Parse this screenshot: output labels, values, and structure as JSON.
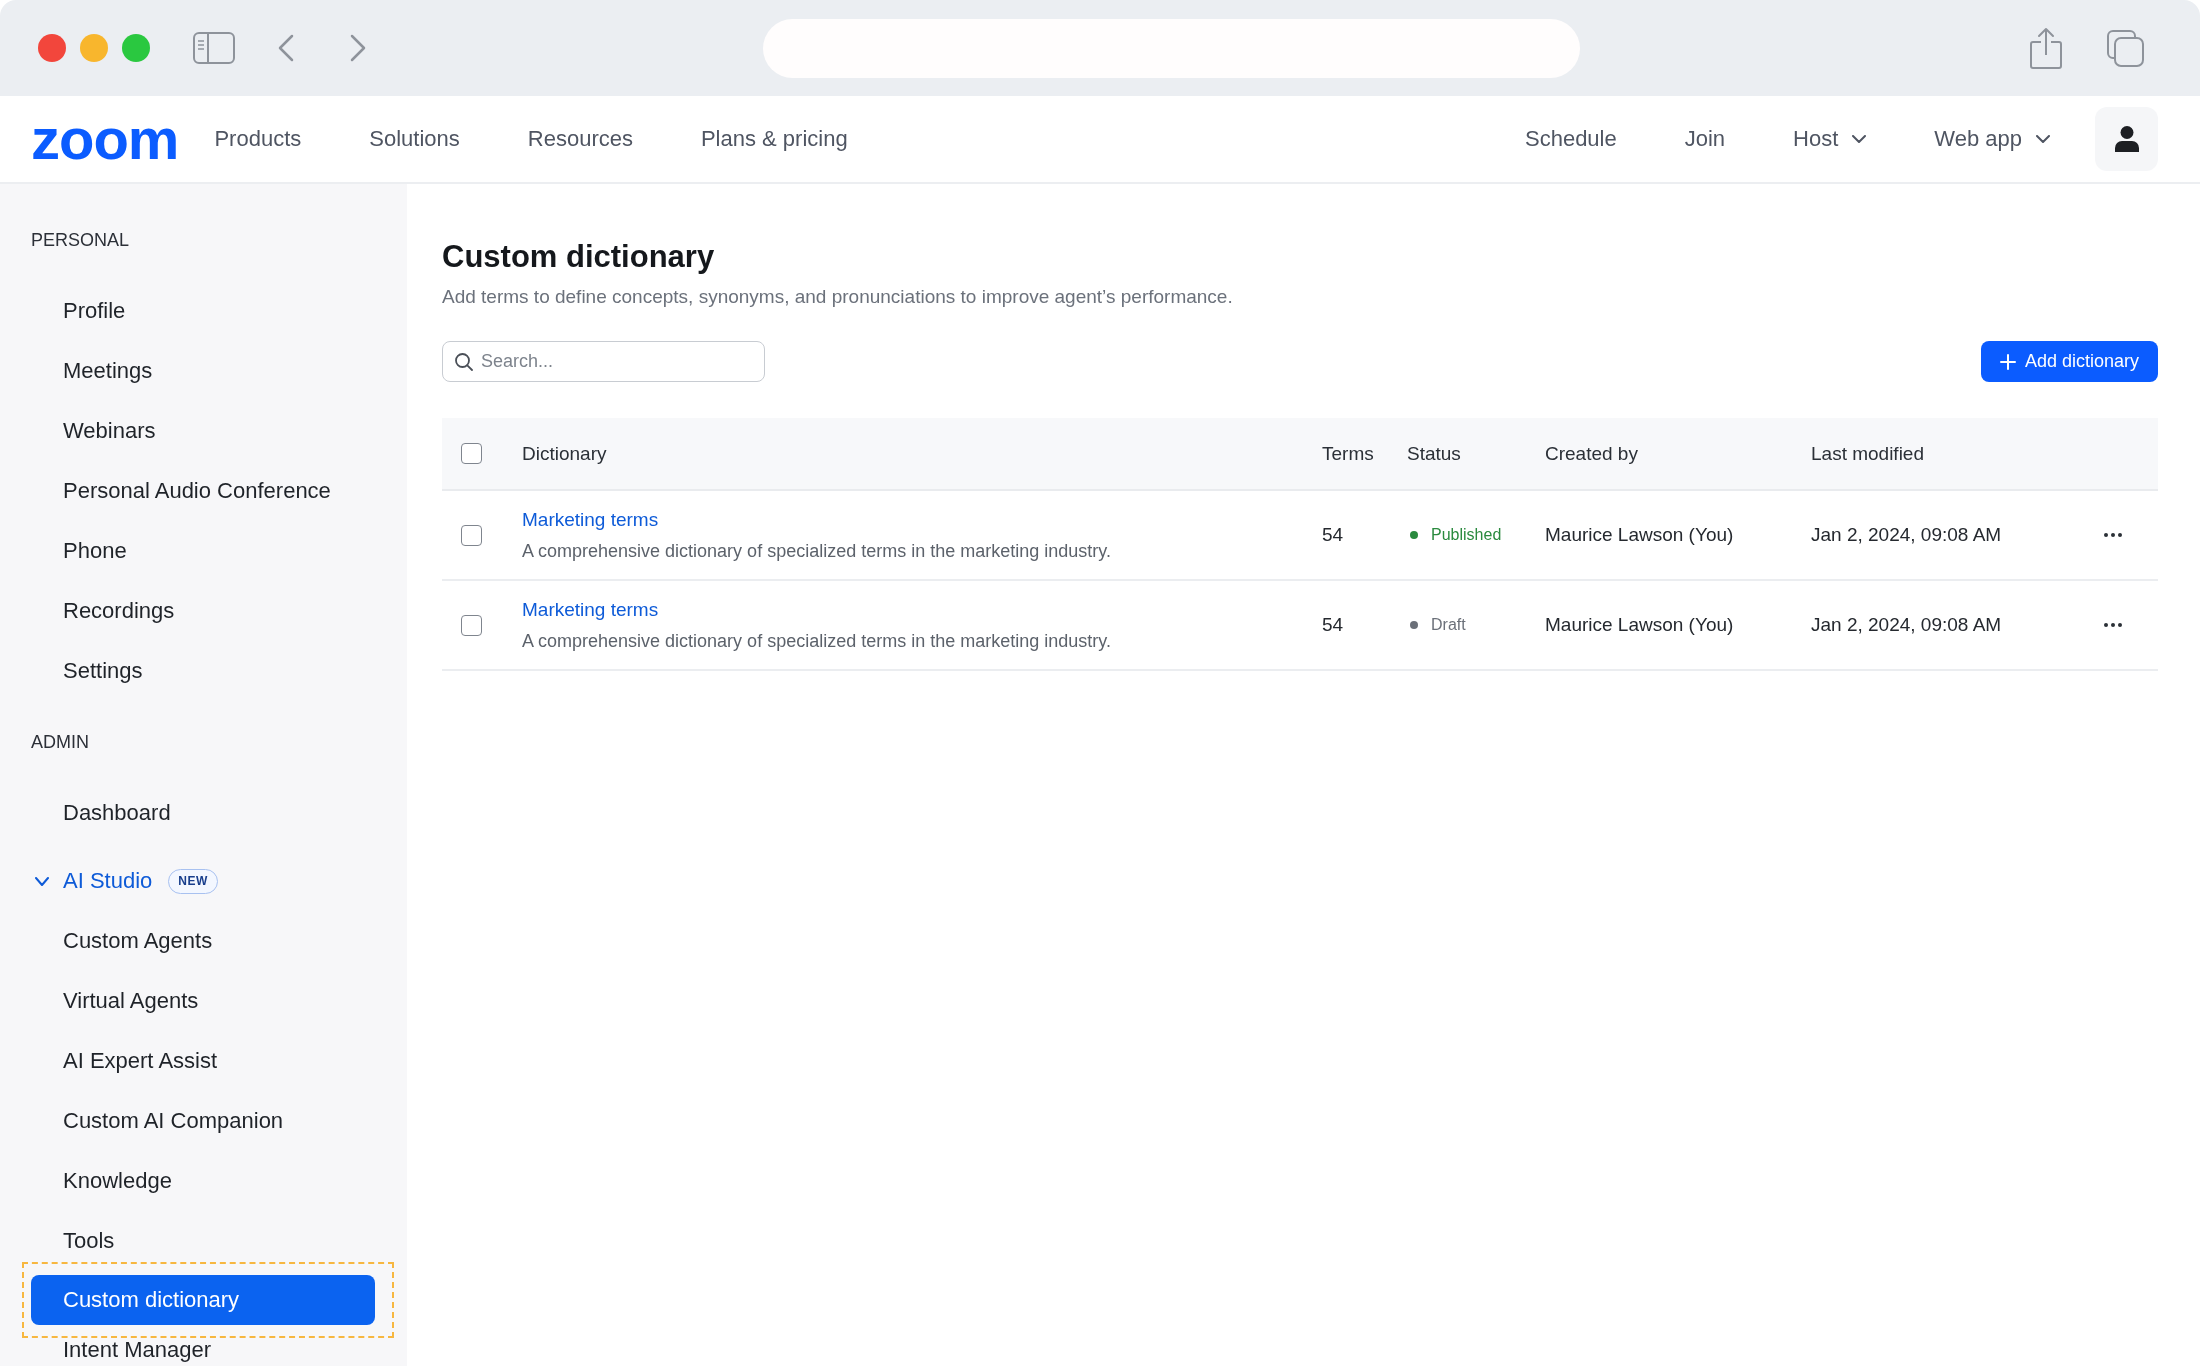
{
  "navbar": {
    "logo": "zoom",
    "links": [
      {
        "label": "Products"
      },
      {
        "label": "Solutions"
      },
      {
        "label": "Resources"
      },
      {
        "label": "Plans & pricing"
      }
    ],
    "actions": [
      {
        "label": "Schedule",
        "kind": "link"
      },
      {
        "label": "Join",
        "kind": "link"
      },
      {
        "label": "Host",
        "kind": "menu"
      },
      {
        "label": "Web app",
        "kind": "menu"
      }
    ]
  },
  "sidebar": {
    "sections": [
      {
        "heading": "PERSONAL",
        "items": [
          {
            "label": "Profile",
            "selected": false
          },
          {
            "label": "Meetings",
            "selected": false
          },
          {
            "label": "Webinars",
            "selected": false
          },
          {
            "label": "Personal Audio Conference",
            "selected": false
          },
          {
            "label": "Phone",
            "selected": false
          },
          {
            "label": "Recordings",
            "selected": false
          },
          {
            "label": "Settings",
            "selected": false
          }
        ]
      },
      {
        "heading": "ADMIN",
        "items": [
          {
            "label": "Dashboard",
            "selected": false
          },
          {
            "label": "AI Studio",
            "selected": false,
            "expanded": true,
            "badge": "NEW",
            "children": [
              {
                "label": "Custom Agents",
                "selected": false
              },
              {
                "label": "Virtual Agents",
                "selected": false
              },
              {
                "label": "AI Expert Assist",
                "selected": false
              },
              {
                "label": "Custom AI Companion",
                "selected": false
              },
              {
                "label": "Knowledge",
                "selected": false
              },
              {
                "label": "Tools",
                "selected": false
              },
              {
                "label": "Custom dictionary",
                "selected": true
              },
              {
                "label": "Intent Manager",
                "selected": false
              }
            ]
          }
        ]
      }
    ]
  },
  "page": {
    "title": "Custom dictionary",
    "description": "Add terms to define concepts, synonyms, and pronunciations to improve agent’s performance.",
    "search": {
      "placeholder": "Search..."
    },
    "add_button": "Add dictionary"
  },
  "table": {
    "header_checked": false,
    "columns": [
      {
        "label": "Dictionary"
      },
      {
        "label": "Terms"
      },
      {
        "label": "Status"
      },
      {
        "label": "Created by"
      },
      {
        "label": "Last modified"
      }
    ],
    "rows": [
      {
        "checked": false,
        "name": "Marketing terms",
        "description": "A comprehensive dictionary of specialized terms in the marketing industry.",
        "terms": "54",
        "status": {
          "label": "Published",
          "color": "#2a8a3e"
        },
        "created_by": "Maurice Lawson (You)",
        "last_modified": "Jan 2, 2024, 09:08 AM"
      },
      {
        "checked": false,
        "name": "Marketing terms",
        "description": "A comprehensive dictionary of specialized terms in the marketing industry.",
        "terms": "54",
        "status": {
          "label": "Draft",
          "color": "#6b7079"
        },
        "created_by": "Maurice Lawson (You)",
        "last_modified": "Jan 2, 2024, 09:08 AM"
      }
    ]
  }
}
